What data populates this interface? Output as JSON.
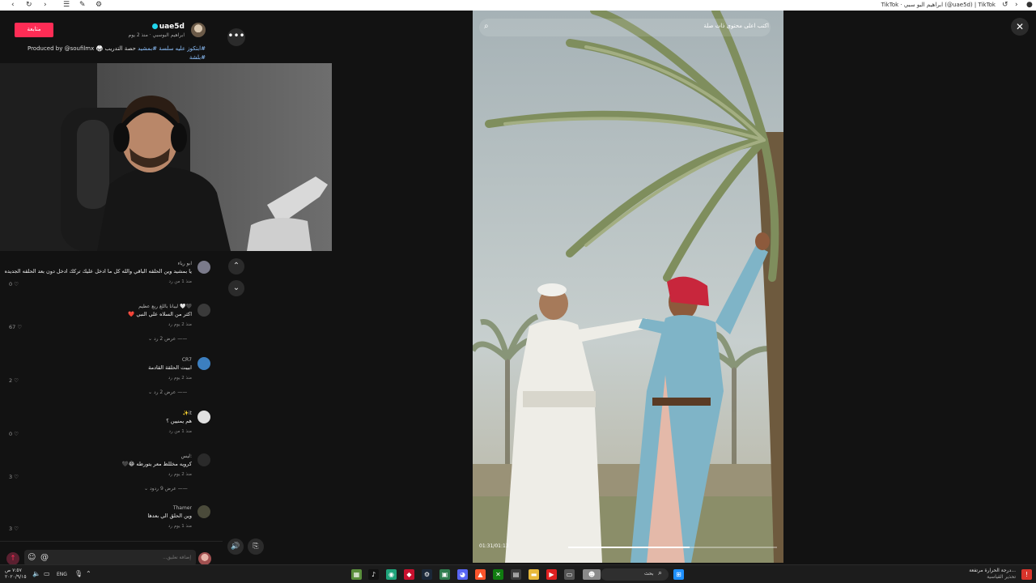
{
  "browser": {
    "title": "TikTok · ابراهيم البو سبي (@uae5d) | TikTok",
    "icons": [
      "back-icon",
      "refresh-icon",
      "menu-icon",
      "tools-icon",
      "forward-icon"
    ]
  },
  "post": {
    "follow_label": "متابعة",
    "author": "uae5d",
    "author_sub": "ابراهيم البوسبي · منذ 2 يوم",
    "caption_prefix": "حصة التدريب 🥋 Produced by @soufilmx",
    "caption_tags": [
      "#بمشيد",
      "#ابتكوز عليه سلسة",
      "#بلشة"
    ]
  },
  "comments": [
    {
      "user": "ابو رياء",
      "text": "يا بمشيد وين الحلقه الباقي والله كل ما ادخل عليك تركك ادخل دون بعد الحلقه الجديده",
      "meta": "منذ 1 من رد",
      "likes": "0"
    },
    {
      "user": "ليبانا باللغ ربع عظيم 🤍🖤",
      "text": "اكثر من السلاه علي النبي ❤️",
      "meta": "منذ 2 يوم رد",
      "likes": "67",
      "replies": "عرض 2 رد"
    },
    {
      "user": "CR7",
      "text": "ابيبت الحلقة القادمة",
      "meta": "منذ 2 يوم رد",
      "likes": "2",
      "replies": "عرض 2 رد"
    },
    {
      "user": "✨it",
      "text": "هم يمنيين ؟",
      "meta": "منذ 1 من رد",
      "likes": "0"
    },
    {
      "user": "ليس:",
      "text": "كرويه مخللظ معر يتورطه 😂🖤",
      "meta": "منذ 2 يوم رد",
      "likes": "3",
      "replies": "عرض 9 ردود"
    },
    {
      "user": "Thamer",
      "text": "وين الحلق الي بعدها",
      "meta": "منذ 1 يوم رد",
      "likes": "3"
    }
  ],
  "comment_bar": {
    "placeholder": "إضافة تعليق..."
  },
  "video": {
    "search_text": "اكتب اعلى محتوى ذات صلة",
    "time": "01:31/01:13",
    "progress": 0.58
  },
  "taskbar": {
    "lang": "ENG",
    "clock_time": "٧:٥٧ ص",
    "clock_date": "٢٠٢٠/٩/١٥",
    "weather_line1": "درجة الحرارة مرتفعة...",
    "weather_line2": "تحذير القياسية",
    "search_label": "بحث"
  }
}
